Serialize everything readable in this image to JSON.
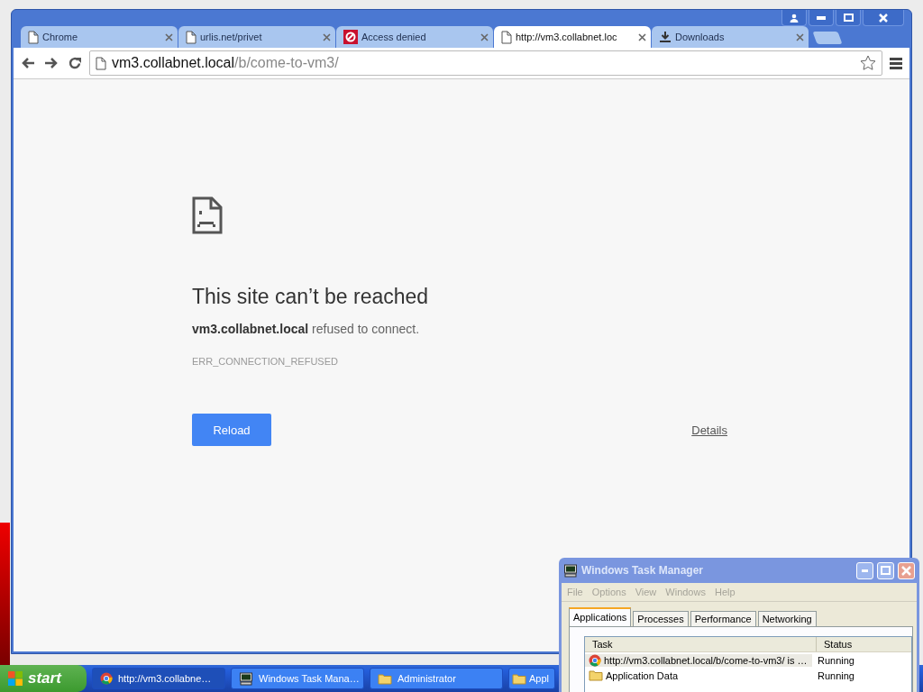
{
  "browser": {
    "tabs": [
      {
        "title": "Chrome",
        "selected": false
      },
      {
        "title": "urlis.net/privet",
        "selected": false
      },
      {
        "title": "Access denied",
        "selected": false
      },
      {
        "title": "http://vm3.collabnet.loc",
        "selected": true
      },
      {
        "title": "Downloads",
        "selected": false
      }
    ],
    "address": {
      "host": "vm3.collabnet.local",
      "path": "/b/come-to-vm3/"
    },
    "error": {
      "title": "This site can’t be reached",
      "message": "**vm3.collabnet.local** refused to connect.",
      "code": "ERR_CONNECTION_REFUSED",
      "reload": "Reload",
      "details": "Details"
    }
  },
  "task_manager": {
    "title": "Windows Task Manager",
    "menu": [
      "File",
      "Options",
      "View",
      "Windows",
      "Help"
    ],
    "tabs": [
      {
        "label": "Applications",
        "selected": true
      },
      {
        "label": "Processes",
        "selected": false
      },
      {
        "label": "Performance",
        "selected": false
      },
      {
        "label": "Networking",
        "selected": false
      }
    ],
    "columns": [
      "Task",
      "Status"
    ],
    "rows": [
      {
        "task": "http://vm3.collabnet.local/b/come-to-vm3/ is …",
        "status": "Running",
        "selected": true
      },
      {
        "task": "Application Data",
        "status": "Running",
        "selected": false
      }
    ]
  },
  "taskbar": {
    "start": "start",
    "items": [
      {
        "label": "http://vm3.collabne…",
        "selected": true
      },
      {
        "label": "Windows Task Mana…",
        "selected": false
      },
      {
        "label": "Administrator",
        "selected": false
      },
      {
        "label": "Appl",
        "selected": false
      }
    ]
  }
}
